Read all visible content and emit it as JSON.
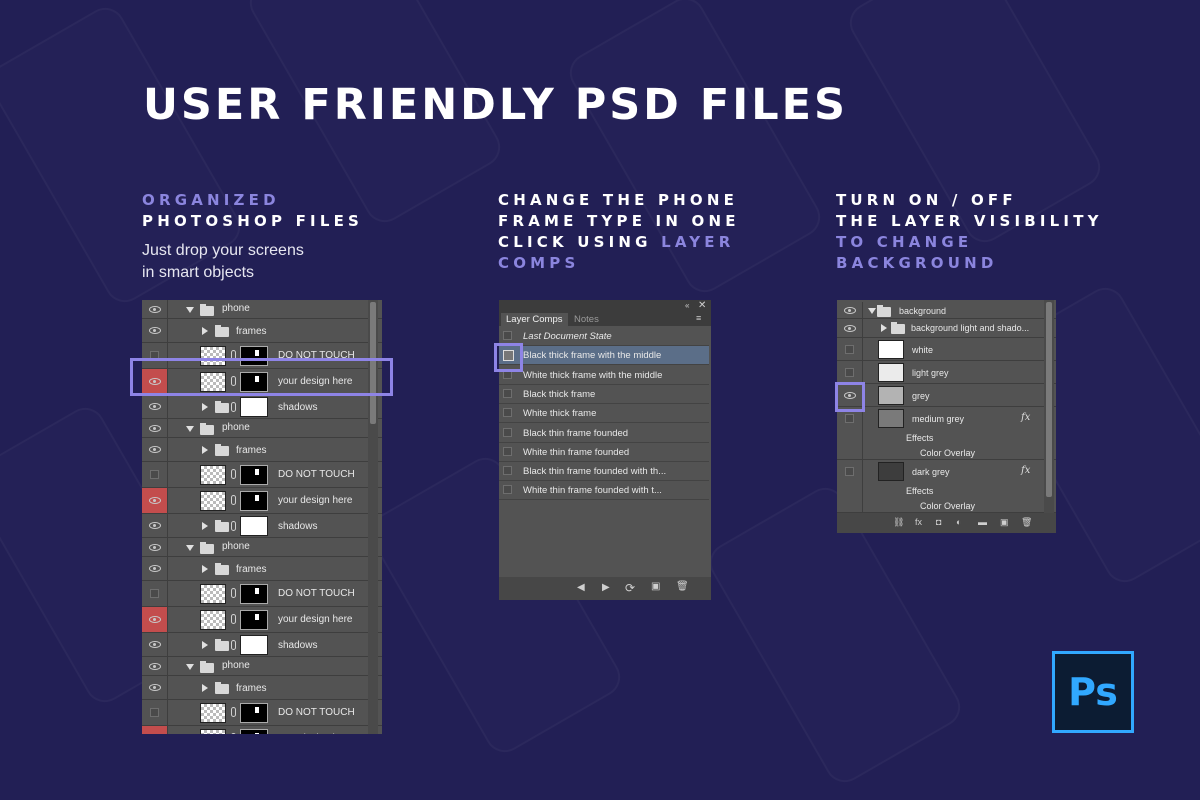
{
  "headline": "USER FRIENDLY PSD FILES",
  "columns": [
    {
      "lines": [
        {
          "text": "ORGANIZED",
          "accent": true
        },
        {
          "text": "PHOTOSHOP FILES",
          "accent": false
        }
      ],
      "sub": [
        "Just drop your screens",
        "in smart objects"
      ]
    },
    {
      "lines": [
        {
          "text": "CHANGE THE PHONE",
          "accent": false
        },
        {
          "text": "FRAME TYPE IN ONE",
          "accent": false
        },
        {
          "text": "CLICK USING ",
          "accent": false,
          "tail": "LAYER"
        },
        {
          "text": "COMPS",
          "accent": true
        }
      ]
    },
    {
      "lines": [
        {
          "text": "TURN ON / OFF",
          "accent": false
        },
        {
          "text": "THE LAYER VISIBILITY",
          "accent": false
        },
        {
          "text": "TO CHANGE",
          "accent": true
        },
        {
          "text": "BACKGROUND",
          "accent": true
        }
      ]
    }
  ],
  "layers_panel": {
    "groups": [
      {
        "name": "phone",
        "frames": "frames",
        "do_not_touch": "DO NOT TOUCH",
        "design": "your design here",
        "shadows": "shadows"
      },
      {
        "name": "phone",
        "frames": "frames",
        "do_not_touch": "DO NOT TOUCH",
        "design": "your design here",
        "shadows": "shadows"
      },
      {
        "name": "phone",
        "frames": "frames",
        "do_not_touch": "DO NOT TOUCH",
        "design": "your design here",
        "shadows": "shadows"
      },
      {
        "name": "phone",
        "frames": "frames",
        "do_not_touch": "DO NOT TOUCH",
        "design": "your design here"
      }
    ]
  },
  "layer_comps": {
    "tabs": [
      "Layer Comps",
      "Notes"
    ],
    "items": [
      "Last Document State",
      "Black thick frame with the middle",
      "White thick frame with the middle",
      "Black thick frame",
      "White thick frame",
      "Black thin frame founded",
      "White thin frame founded",
      "Black thin frame founded with th...",
      "White thin frame founded with t..."
    ],
    "selected_index": 1
  },
  "background_panel": {
    "group": "background",
    "sub_group": "background light and shado...",
    "layers": [
      "white",
      "light grey",
      "grey",
      "medium grey",
      "dark grey"
    ],
    "effects_label": "Effects",
    "color_overlay": "Color Overlay",
    "fx_label": "fx"
  },
  "logo_text": "Ps",
  "colors": {
    "background": "#221f55",
    "accent": "#8b85de",
    "highlight": "#8e84e6",
    "ps_blue": "#31a8ff",
    "red_eye": "#c34d4d"
  }
}
